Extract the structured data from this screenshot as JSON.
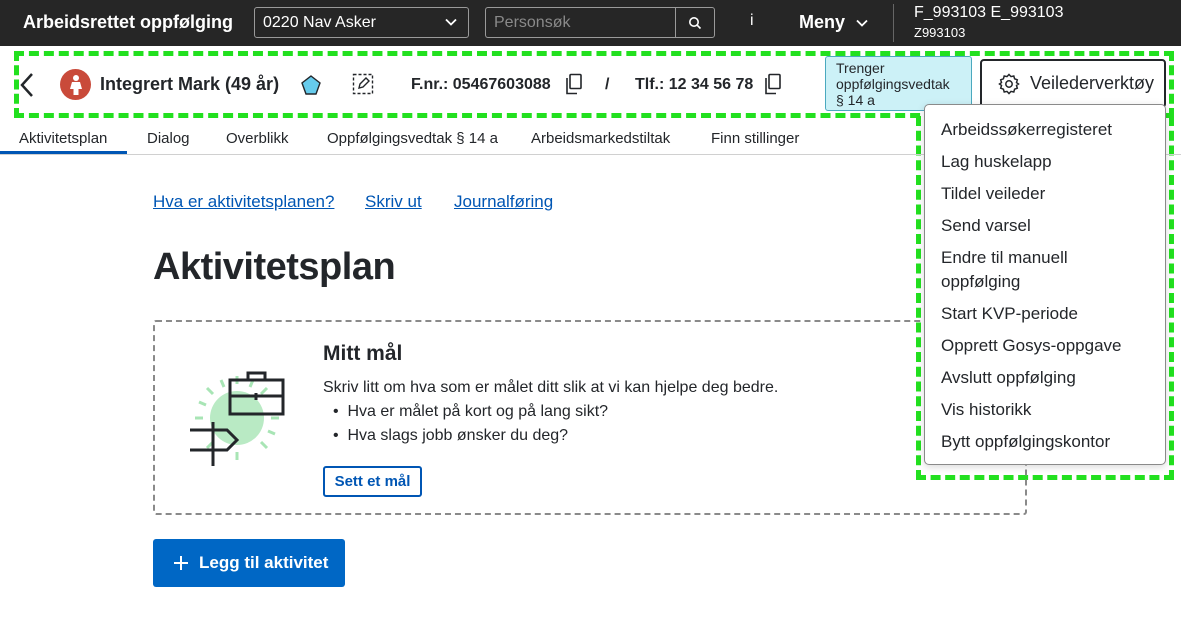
{
  "topbar": {
    "app_title": "Arbeidsrettet oppfølging",
    "office_select": "0220 Nav Asker",
    "search_placeholder": "Personsøk",
    "info_label": "i",
    "menu_label": "Meny",
    "user_name": "F_993103 E_993103",
    "user_id": "Z993103"
  },
  "person": {
    "name": "Integrert Mark (49 år)",
    "fnr": "F.nr.: 05467603088",
    "separator": "/",
    "tlf": "Tlf.: 12 34 56 78",
    "badge": "Trenger oppfølgingsvedtak § 14 a",
    "tools_button": "Veilederverktøy"
  },
  "tabs": [
    "Aktivitetsplan",
    "Dialog",
    "Overblikk",
    "Oppfølgingsvedtak § 14 a",
    "Arbeidsmarkedstiltak",
    "Finn stillinger"
  ],
  "links": [
    "Hva er aktivitetsplanen?",
    "Skriv ut",
    "Journalføring"
  ],
  "page_title": "Aktivitetsplan",
  "goal": {
    "title": "Mitt mål",
    "description": "Skriv litt om hva som er målet ditt slik at vi kan hjelpe deg bedre.",
    "bullets": [
      "Hva er målet på kort og på lang sikt?",
      "Hva slags jobb ønsker du deg?"
    ],
    "button": "Sett et mål"
  },
  "add_activity_button": "Legg til aktivitet",
  "tools_menu": [
    "Arbeidssøkerregisteret",
    "Lag huskelapp",
    "Tildel veileder",
    "Send varsel",
    "Endre til manuell oppfølging",
    "Start KVP-periode",
    "Opprett Gosys-oppgave",
    "Avslutt oppfølging",
    "Vis historikk",
    "Bytt oppfølgingskontor"
  ],
  "colors": {
    "topbar_bg": "#262626",
    "accent_blue": "#0067c5",
    "link_blue": "#0056b4",
    "badge_bg": "#ccf1f7",
    "highlight_dash": "#22e01f",
    "avatar_bg": "#c94a3a"
  }
}
